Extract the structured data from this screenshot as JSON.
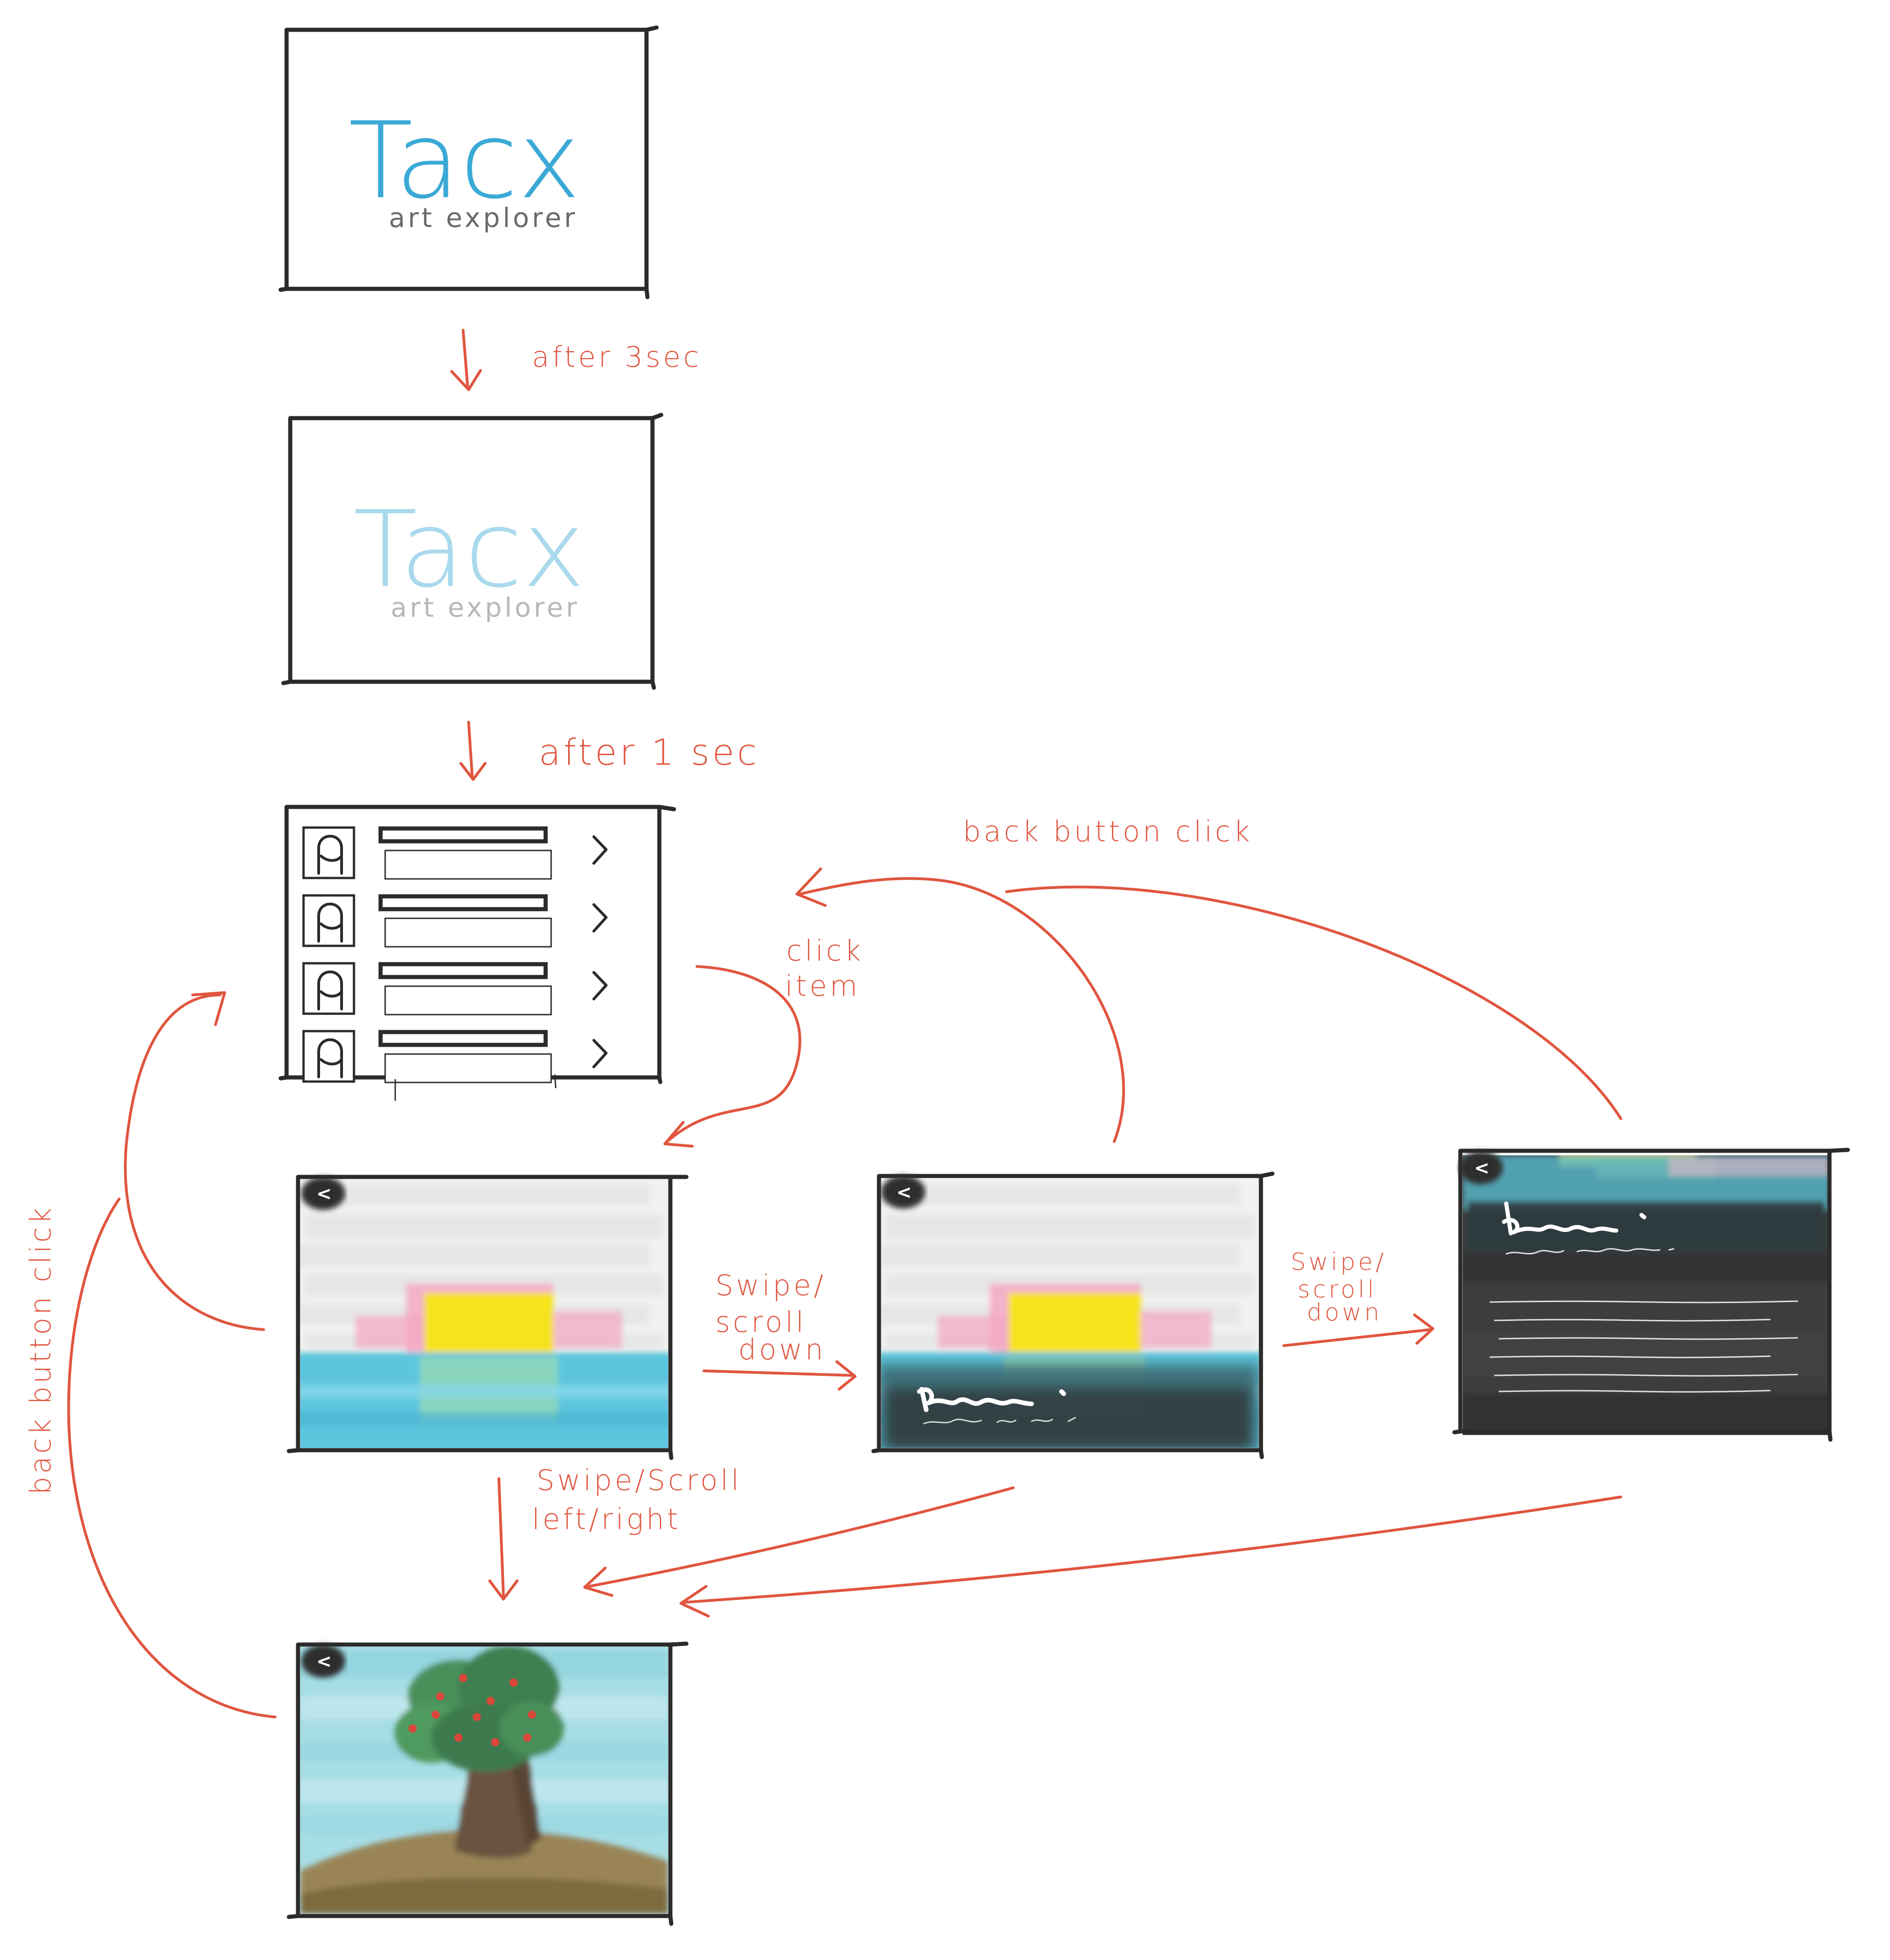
{
  "screens": {
    "splash": {
      "logo_title": "Tacx",
      "logo_subtitle": "art explorer",
      "title_color": "#3aa9d6",
      "subtitle_color": "#6b6b6b"
    },
    "splash_fade": {
      "logo_title": "Tacx",
      "logo_subtitle": "art explorer",
      "title_color": "#a9d9ec",
      "subtitle_color": "#b8b8b8"
    },
    "list": {
      "item_count": 4,
      "icons": [
        "person-icon",
        "person-icon",
        "person-icon",
        "person-icon"
      ],
      "chevron": "chevron-right-icon"
    },
    "detail_image": {
      "back_label": "<",
      "artwork": "sunset-over-sea"
    },
    "detail_partial": {
      "back_label": "<",
      "artwork": "sunset-over-sea"
    },
    "detail_info": {
      "back_label": "<",
      "artwork": "sunset-over-sea"
    },
    "next_artwork": {
      "back_label": "<",
      "artwork": "tree-on-hill"
    }
  },
  "annotations": {
    "after_3sec": "after 3sec",
    "after_1sec": "after 1 sec",
    "click_item_1": "click",
    "click_item_2": "item",
    "back_button_click_top": "back button click",
    "back_button_click_left": "back button click",
    "swipe_down_1_a": "Swipe/",
    "swipe_down_1_b": "scroll",
    "swipe_down_1_c": "down",
    "swipe_down_2_a": "Swipe/",
    "swipe_down_2_b": "scroll",
    "swipe_down_2_c": "down",
    "swipe_lr_a": "Swipe/Scroll",
    "swipe_lr_b": "left/right"
  },
  "colors": {
    "annotation": "#e0553f",
    "frame": "#2b2b2b",
    "sky_cloud": "#e6e7e5",
    "sun": "#f6e31a",
    "pink": "#f4a9c4",
    "sea": "#5cc6de",
    "dark_panel": "#34383a",
    "leaf": "#4a8f5a",
    "trunk": "#6b5340",
    "ground": "#9a8457"
  }
}
